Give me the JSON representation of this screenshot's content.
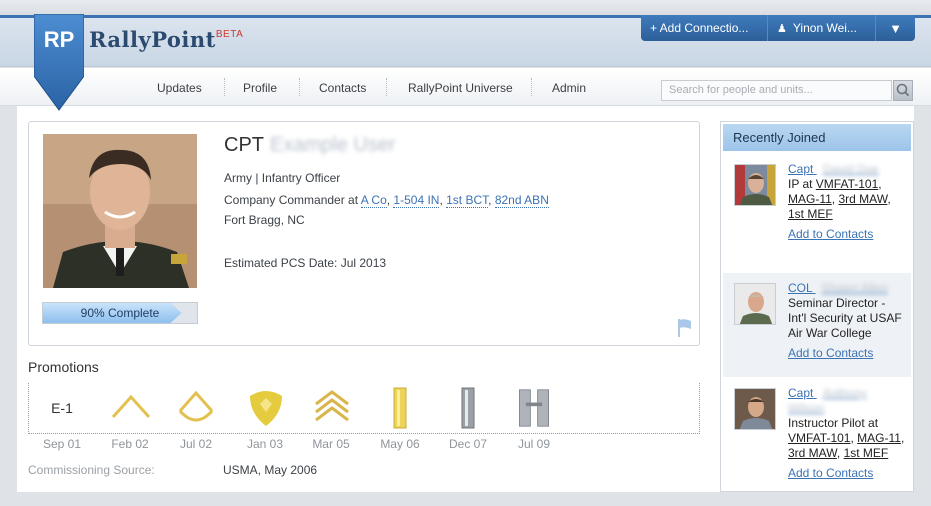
{
  "brand": {
    "logo_initials": "RP",
    "name": "RallyPoint",
    "beta": "BETA"
  },
  "account": {
    "add_connections": "+ Add Connectio...",
    "user": "Yinon Wei...",
    "menu_glyph": "▼"
  },
  "nav": [
    "Updates",
    "Profile",
    "Contacts",
    "RallyPoint Universe",
    "Admin"
  ],
  "search": {
    "placeholder": "Search for people and units..."
  },
  "profile": {
    "rank": "CPT",
    "name": "Example User",
    "line1": "Army | Infantry Officer",
    "role_prefix": "Company Commander at ",
    "units": [
      "A Co",
      "1-504 IN",
      "1st BCT",
      "82nd ABN"
    ],
    "location": "Fort Bragg, NC",
    "pcs": "Estimated PCS Date: Jul 2013",
    "progress_label": "90% Complete",
    "progress_pct": 90
  },
  "promotions": {
    "title": "Promotions",
    "first_label": "E-1",
    "dates": [
      "Sep 01",
      "Feb 02",
      "Jul 02",
      "Jan 03",
      "Mar 05",
      "May 06",
      "Dec 07",
      "Jul 09"
    ],
    "commissioning_label": "Commissioning Source:",
    "commissioning_value": "USMA, May 2006"
  },
  "recently_joined": {
    "title": "Recently Joined",
    "entries": [
      {
        "rank": "Capt",
        "name": "David Doe",
        "lines": [
          "IP at "
        ],
        "orgs": [
          "VMFAT-101",
          "MAG-11",
          "3rd MAW",
          "1st MEF"
        ],
        "action": "Add to Contacts"
      },
      {
        "rank": "COL",
        "name": "Shawn Allen",
        "description": "Seminar Director - Int'l Security at USAF Air War College",
        "action": "Add to Contacts"
      },
      {
        "rank": "Capt",
        "name": "Anthony Wilson",
        "lines": [
          "Instructor Pilot at "
        ],
        "orgs": [
          "VMFAT-101",
          "MAG-11",
          "3rd MAW",
          "1st MEF"
        ],
        "action": "Add to Contacts"
      }
    ]
  },
  "colors": {
    "accent": "#3b73b3",
    "header_bar": "#2c5f99",
    "beta": "#cc3a2a"
  }
}
